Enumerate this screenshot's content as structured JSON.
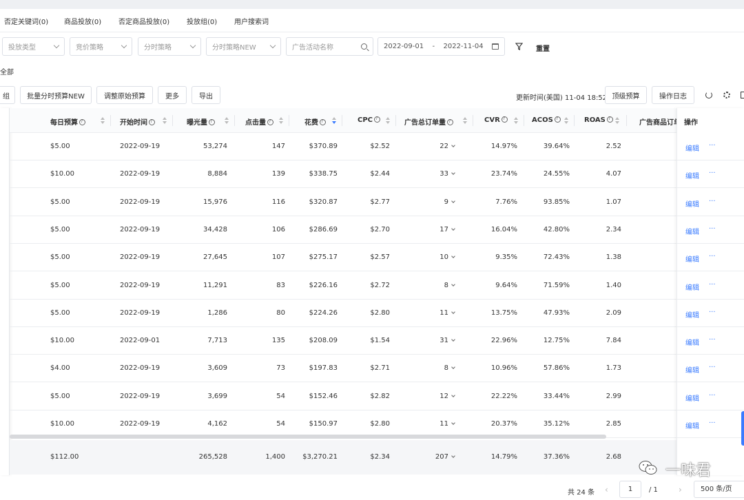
{
  "tabs": [
    "否定关键词(0)",
    "商品投放(0)",
    "否定商品投放(0)",
    "投放组(0)",
    "用户搜索词"
  ],
  "filters": {
    "ad_type": "投放类型",
    "bid_strategy": "竞价策略",
    "time_strategy": "分时策略",
    "time_strategy_new": "分时策略NEW",
    "campaign_search_placeholder": "广告活动名称",
    "date_start": "2022-09-01",
    "date_sep": "-",
    "date_end": "2022-11-04",
    "reset": "重置"
  },
  "show_all": "全部",
  "toolbar": {
    "group": "组",
    "batch_budget": "批量分时预算NEW",
    "adjust_budget": "调整原始预算",
    "more": "更多",
    "export": "导出",
    "update_time": "更新时间(美国) 11-04 18:52",
    "top_budget": "顶级预算",
    "op_log": "操作日志"
  },
  "columns": [
    "每日预算",
    "开始时间",
    "曝光量",
    "点击量",
    "花费",
    "CPC",
    "广告总订单量",
    "CVR",
    "ACOS",
    "ROAS",
    "广告商品订单",
    "操作"
  ],
  "rows": [
    {
      "budget": "$5.00",
      "start": "2022-09-19",
      "impr": "53,274",
      "clicks": "147",
      "spend": "$370.89",
      "cpc": "$2.52",
      "orders": "22",
      "cvr": "14.97%",
      "acos": "39.64%",
      "roas": "2.52"
    },
    {
      "budget": "$10.00",
      "start": "2022-09-19",
      "impr": "8,884",
      "clicks": "139",
      "spend": "$338.75",
      "cpc": "$2.44",
      "orders": "33",
      "cvr": "23.74%",
      "acos": "24.55%",
      "roas": "4.07"
    },
    {
      "budget": "$5.00",
      "start": "2022-09-19",
      "impr": "15,976",
      "clicks": "116",
      "spend": "$320.87",
      "cpc": "$2.77",
      "orders": "9",
      "cvr": "7.76%",
      "acos": "93.85%",
      "roas": "1.07"
    },
    {
      "budget": "$5.00",
      "start": "2022-09-19",
      "impr": "34,428",
      "clicks": "106",
      "spend": "$286.69",
      "cpc": "$2.70",
      "orders": "17",
      "cvr": "16.04%",
      "acos": "42.80%",
      "roas": "2.34"
    },
    {
      "budget": "$5.00",
      "start": "2022-09-19",
      "impr": "27,645",
      "clicks": "107",
      "spend": "$275.17",
      "cpc": "$2.57",
      "orders": "10",
      "cvr": "9.35%",
      "acos": "72.43%",
      "roas": "1.38"
    },
    {
      "budget": "$5.00",
      "start": "2022-09-19",
      "impr": "11,291",
      "clicks": "83",
      "spend": "$226.16",
      "cpc": "$2.72",
      "orders": "8",
      "cvr": "9.64%",
      "acos": "71.59%",
      "roas": "1.40"
    },
    {
      "budget": "$5.00",
      "start": "2022-09-19",
      "impr": "1,286",
      "clicks": "80",
      "spend": "$224.26",
      "cpc": "$2.80",
      "orders": "11",
      "cvr": "13.75%",
      "acos": "47.93%",
      "roas": "2.09"
    },
    {
      "budget": "$10.00",
      "start": "2022-09-01",
      "impr": "7,713",
      "clicks": "135",
      "spend": "$208.09",
      "cpc": "$1.54",
      "orders": "31",
      "cvr": "22.96%",
      "acos": "12.75%",
      "roas": "7.84"
    },
    {
      "budget": "$4.00",
      "start": "2022-09-19",
      "impr": "3,609",
      "clicks": "73",
      "spend": "$197.83",
      "cpc": "$2.71",
      "orders": "8",
      "cvr": "10.96%",
      "acos": "57.86%",
      "roas": "1.73"
    },
    {
      "budget": "$5.00",
      "start": "2022-09-19",
      "impr": "3,699",
      "clicks": "54",
      "spend": "$152.46",
      "cpc": "$2.82",
      "orders": "12",
      "cvr": "22.22%",
      "acos": "33.44%",
      "roas": "2.99"
    },
    {
      "budget": "$10.00",
      "start": "2022-09-19",
      "impr": "4,162",
      "clicks": "54",
      "spend": "$150.97",
      "cpc": "$2.80",
      "orders": "11",
      "cvr": "20.37%",
      "acos": "35.12%",
      "roas": "2.85"
    }
  ],
  "edit_label": "编辑",
  "more_label": "···",
  "summary": {
    "budget": "$112.00",
    "impr": "265,528",
    "clicks": "1,400",
    "spend": "$3,270.21",
    "cpc": "$2.34",
    "orders": "207",
    "cvr": "14.79%",
    "acos": "37.36%",
    "roas": "2.68"
  },
  "pagination": {
    "total": "共 24 条",
    "page": "1",
    "pages": "/  1",
    "page_size": "500 条/页"
  },
  "watermark": "一味君",
  "colors": {
    "accent": "#3a7bff",
    "border": "#dcdfe6",
    "header_bg": "#fafbfc",
    "summary_bg": "#f5f6f8"
  }
}
